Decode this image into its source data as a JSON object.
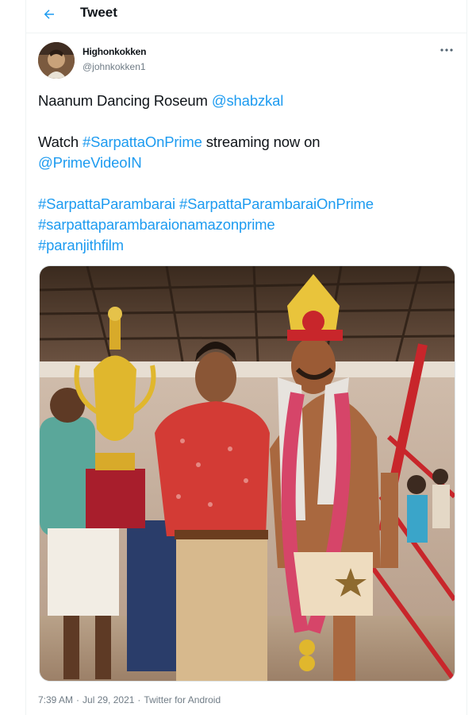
{
  "header": {
    "title": "Tweet",
    "back_icon": "arrow-left-icon"
  },
  "author": {
    "name": "Highonkokken",
    "handle": "@johnkokken1"
  },
  "tweet": {
    "l1_text": "Naanum Dancing Roseum ",
    "l1_mention": "@shabzkal",
    "l2_text_a": "Watch ",
    "l2_hashtag": "#SarpattaOnPrime",
    "l2_text_b": " streaming now on",
    "l3_mention": "@PrimeVideoIN",
    "h1": "#SarpattaParambarai",
    "h2": "#SarpattaParambaraiOnPrime",
    "h3": "#sarpattaparambaraionamazonprime",
    "h4": "#paranjithfilm"
  },
  "meta": {
    "time": "7:39 AM",
    "sep1": "·",
    "date": "Jul 29, 2021",
    "sep2": "·",
    "source": "Twitter for Android"
  },
  "colors": {
    "link": "#1d9bf0",
    "text": "#0f1419",
    "muted": "#707c86"
  },
  "icons": {
    "more": "more-horizontal-icon"
  }
}
